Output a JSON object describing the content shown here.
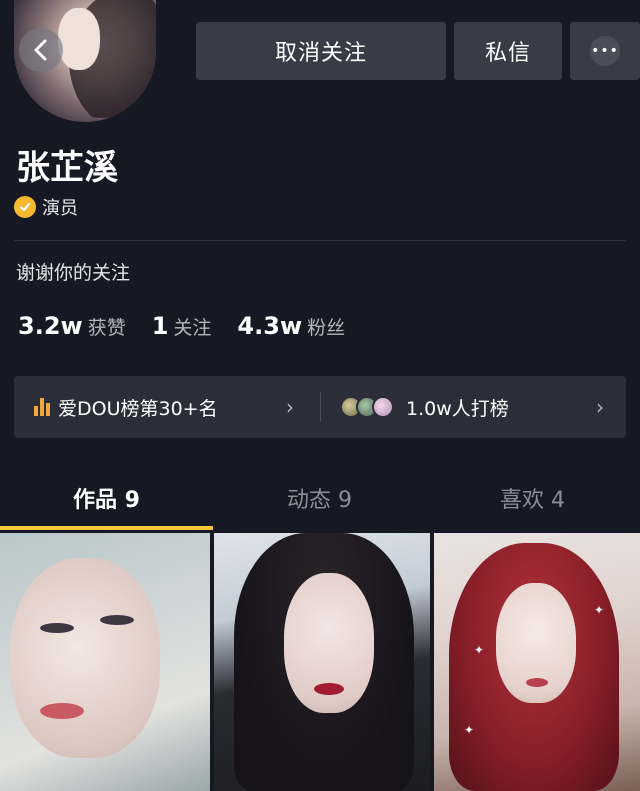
{
  "profile": {
    "name": "张芷溪",
    "verified_label": "演员",
    "bio": "谢谢你的关注"
  },
  "header": {
    "unfollow_label": "取消关注",
    "message_label": "私信",
    "more_label": "•••"
  },
  "stats": [
    {
      "value": "3.2w",
      "label": "获赞"
    },
    {
      "value": "1",
      "label": "关注"
    },
    {
      "value": "4.3w",
      "label": "粉丝"
    }
  ],
  "ranking": {
    "rank_text": "爱DOU榜第30+名",
    "supporters_text": "1.0w人打榜"
  },
  "tabs": [
    {
      "label": "作品 9",
      "active": true
    },
    {
      "label": "动态 9",
      "active": false
    },
    {
      "label": "喜欢 4",
      "active": false
    }
  ],
  "colors": {
    "background": "#161824",
    "button": "#393b46",
    "accent": "#f5c63d",
    "badge": "#f5b92d"
  },
  "icons": [
    "back-icon",
    "verified-icon",
    "more-icon",
    "rank-bars-icon",
    "chevron-right-icon"
  ]
}
